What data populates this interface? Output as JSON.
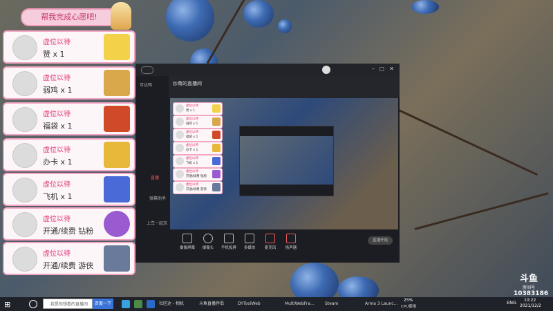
{
  "overlay": {
    "banner": "帮我完成心愿吧!",
    "cards": [
      {
        "name": "虚位以待",
        "text": "赞 x 1",
        "gift_color": "#f3d24a"
      },
      {
        "name": "虚位以待",
        "text": "弱鸡 x 1",
        "gift_color": "#d8a84a"
      },
      {
        "name": "虚位以待",
        "text": "福袋 x 1",
        "gift_color": "#d04a2a"
      },
      {
        "name": "虚位以待",
        "text": "办卡 x 1",
        "gift_color": "#e8b83a"
      },
      {
        "name": "虚位以待",
        "text": "飞机 x 1",
        "gift_color": "#4a6ad8"
      },
      {
        "name": "虚位以待",
        "text": "开通/续费 钻粉",
        "gift_color": "#9a5ad0"
      },
      {
        "name": "虚位以待",
        "text": "开通/续费 游侠",
        "gift_color": "#6a7a9a"
      }
    ]
  },
  "app": {
    "title": "炒茸的直播间",
    "sidebar_labels": [
      "可达鸭",
      "直播",
      "弹幕助手",
      "上车一起玩"
    ],
    "tools": [
      "摄像屏幕",
      "摄像头",
      "手机投屏",
      "多媒体",
      "麦克风",
      "扬声器"
    ],
    "start_button": "直播开始"
  },
  "preview_cards": [
    "赞 x 1",
    "弱鸡 x 1",
    "福袋 x 1",
    "办卡 x 1",
    "飞机 x 1",
    "开通/续费 钻粉",
    "开通/续费 游侠"
  ],
  "taskbar": {
    "search_placeholder": "我是你想看的直播间",
    "search_button": "百度一下",
    "items": [
      "社区达 - 相机",
      "斗鱼直播伴侣",
      "DYToolWeb",
      "MultiWebFra...",
      "Steam",
      "Arma 3 Launc..."
    ],
    "cpu": "25%",
    "cpu_label": "CPU使用",
    "lang": "ENG",
    "time": "10:22",
    "date": "2021/12/2"
  },
  "douyu": {
    "logo": "斗鱼",
    "room_label": "房间号",
    "room_number": "10383186"
  }
}
